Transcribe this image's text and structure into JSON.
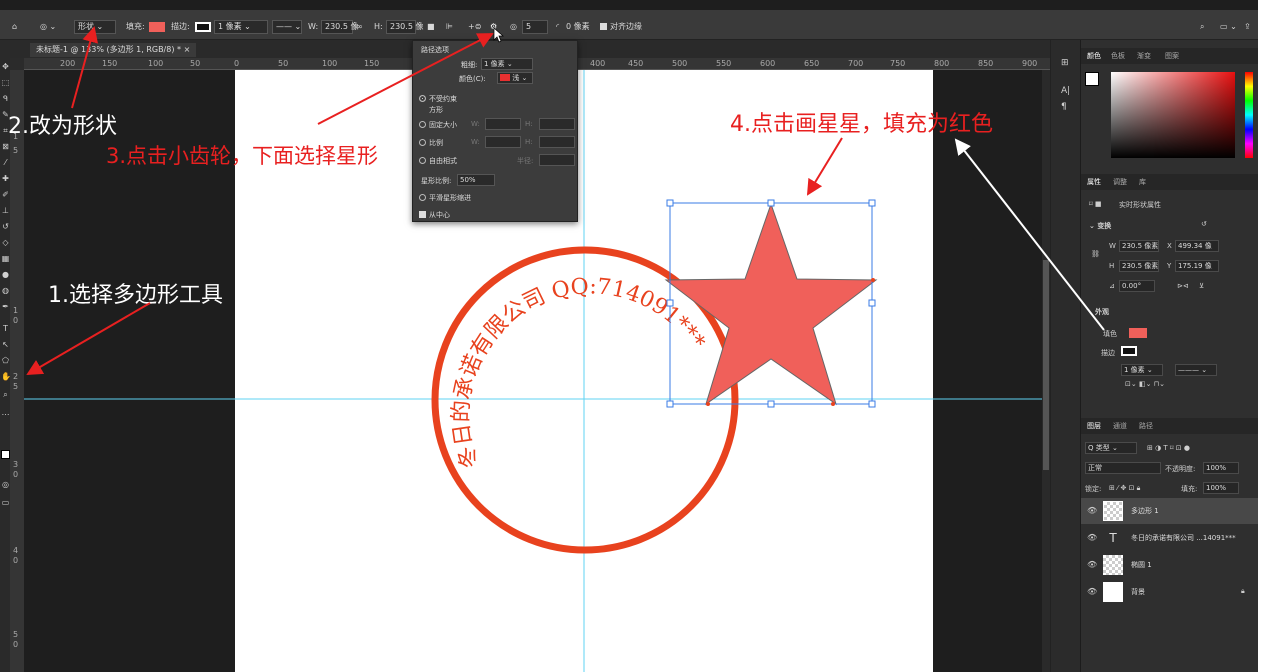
{
  "optionsbar": {
    "mode_label": "形状",
    "fill_label": "填充:",
    "stroke_label": "描边:",
    "stroke_width": "1 像素",
    "w_label": "W:",
    "w_value": "230.5 像",
    "h_label": "H:",
    "h_value": "230.5 像",
    "sides_value": "5",
    "radius_value": "0 像素",
    "align_edges_label": "对齐边缘"
  },
  "document": {
    "tab_title": "未标题-1 @ 133% (多边形 1, RGB/8) *"
  },
  "ruler": {
    "top_ticks": [
      "200",
      "150",
      "100",
      "50",
      "0",
      "50",
      "100",
      "150",
      "",
      "400",
      "450",
      "500",
      "550",
      "600",
      "650",
      "700",
      "750",
      "800",
      "850",
      "900"
    ],
    "left_ticks": [
      "1",
      "5",
      "1",
      "0",
      "2",
      "5",
      "3",
      "0",
      "4",
      "0",
      "5",
      "0"
    ]
  },
  "popup": {
    "title": "路径选项",
    "thickness_label": "粗细:",
    "thickness_value": "1 像素",
    "color_label": "颜色(C):",
    "color_value": "浅",
    "opt_unconstrained": "不受约束",
    "opt_square": "方形",
    "opt_fixed": "固定大小",
    "opt_ratio": "比例",
    "opt_from_center": "自由相式",
    "w_label": "W:",
    "h_label": "H:",
    "radius_label": "半径:",
    "star_ratio_label": "星形比例:",
    "star_ratio_value": "50%",
    "smooth_indent_label": "平滑星形缩进",
    "from_center_label": "从中心"
  },
  "stamp": {
    "arc_text": "冬日的承诺有限公司 QQ:714091***",
    "color": "#e8421e",
    "star_fill": "#f0605a"
  },
  "annotations": {
    "step1": "1.选择多边形工具",
    "step2": "2.改为形状",
    "step3": "3.点击小齿轮，下面选择星形",
    "step4": "4.点击画星星，填充为红色"
  },
  "panels": {
    "color_tabs": [
      "颜色",
      "色板",
      "渐变",
      "图案"
    ],
    "props_tabs": [
      "属性",
      "调整",
      "库"
    ],
    "props_title": "实时形状属性",
    "transform_label": "变换",
    "w_label": "W",
    "w_value": "230.5 像素",
    "x_label": "X",
    "x_value": "499.34 像",
    "h_label": "H",
    "h_value": "230.5 像素",
    "y_label": "Y",
    "y_value": "175.19 像",
    "angle_value": "0.00°",
    "appearance_label": "外观",
    "fill_label": "填色",
    "stroke_label": "描边",
    "stroke_value": "1 像素",
    "layers_tabs": [
      "图层",
      "通道",
      "路径"
    ],
    "kind_label": "Q 类型",
    "blend_mode": "正常",
    "opacity_label": "不透明度:",
    "opacity_value": "100%",
    "lock_label": "锁定:",
    "fill_pct_label": "填充:",
    "fill_pct_value": "100%",
    "layers": [
      {
        "name": "多边形 1",
        "type": "shape"
      },
      {
        "name": "冬日的承诺有限公司 ...14091***",
        "type": "text"
      },
      {
        "name": "椭圆 1",
        "type": "shape"
      },
      {
        "name": "背景",
        "type": "background"
      }
    ]
  },
  "colors": {
    "fill_swatch": "#f0605a",
    "annotation_red": "#e82020",
    "guide": "#5fd3f3"
  }
}
